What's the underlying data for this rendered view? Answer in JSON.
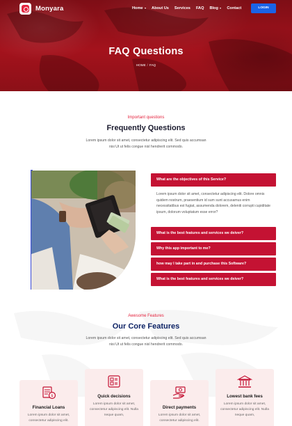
{
  "brand": {
    "name": "Monyara",
    "logo_icon": "app-logo-icon"
  },
  "nav": {
    "items": [
      {
        "label": "Home",
        "has_dropdown": true
      },
      {
        "label": "About Us",
        "has_dropdown": false
      },
      {
        "label": "Services",
        "has_dropdown": false
      },
      {
        "label": "FAQ",
        "has_dropdown": false
      },
      {
        "label": "Blog",
        "has_dropdown": true
      },
      {
        "label": "Contact",
        "has_dropdown": false
      }
    ],
    "login_label": "LOGIN"
  },
  "hero": {
    "title": "FAQ Questions",
    "breadcrumb": [
      "HOME",
      "FAQ"
    ],
    "separator": "/"
  },
  "faq_intro": {
    "eyebrow": "Important questions",
    "title": "Frequently Questions",
    "description": "Lorem ipsum dolor sit amet, consectetur adipiscing elit. Sed quis accumsan nisi Ut ut felis congue nisl hendrerit commodo."
  },
  "faq": {
    "image_alt": "person-holding-wallet-photo",
    "items": [
      {
        "question": "What are the objectives of this Service?",
        "expanded": true,
        "answer": "Lorem ipsum dolor sit amet, consectetur adipiscing elit. Dolore omnis quidem nostrum, praesentium id sum sunt accusamus enim necessitatibus est fugiat, assumenda dolorem, deleniti corrupti cupiditate ipsum, dolorum voluptatum esse error?"
      },
      {
        "question": "What is the best features and services we deiver?",
        "expanded": false
      },
      {
        "question": "Why this app important to me?",
        "expanded": false
      },
      {
        "question": "how may I take part in and purchase this Software?",
        "expanded": false
      },
      {
        "question": "What is the best features and services we deiver?",
        "expanded": false
      }
    ]
  },
  "features": {
    "eyebrow": "Awesome Features",
    "title": "Our Core Features",
    "description": "Lorem ipsum dolor sit amet, consectetur adipiscing elit. Sed quis accumsan nisi Ut ut felis congue nisl hendrerit commodo.",
    "cards": [
      {
        "title": "Financial Loans",
        "icon": "financial-loans-icon",
        "text": "Lorem ipsum dolor sit amet, consectetur adipiscing elit."
      },
      {
        "title": "Quick decisions",
        "icon": "quick-decisions-icon",
        "text": "Lorem ipsum dolor sit amet, consectetur adipiscing elit. Nulla neque quam,"
      },
      {
        "title": "Direct payments",
        "icon": "direct-payments-icon",
        "text": "Lorem ipsum dolor sit amet, consectetur adipiscing elit."
      },
      {
        "title": "Lowest bank fees",
        "icon": "bank-icon",
        "text": "Lorem ipsum dolor sit amet, consectetur adipiscing elit. Nulla neque quam,"
      }
    ]
  },
  "colors": {
    "accent": "#e4233e",
    "accordion": "#c41233",
    "hero": "#a4121c",
    "login": "#1b63e6",
    "features_title": "#0e2466",
    "card_bg": "#fbecec"
  }
}
